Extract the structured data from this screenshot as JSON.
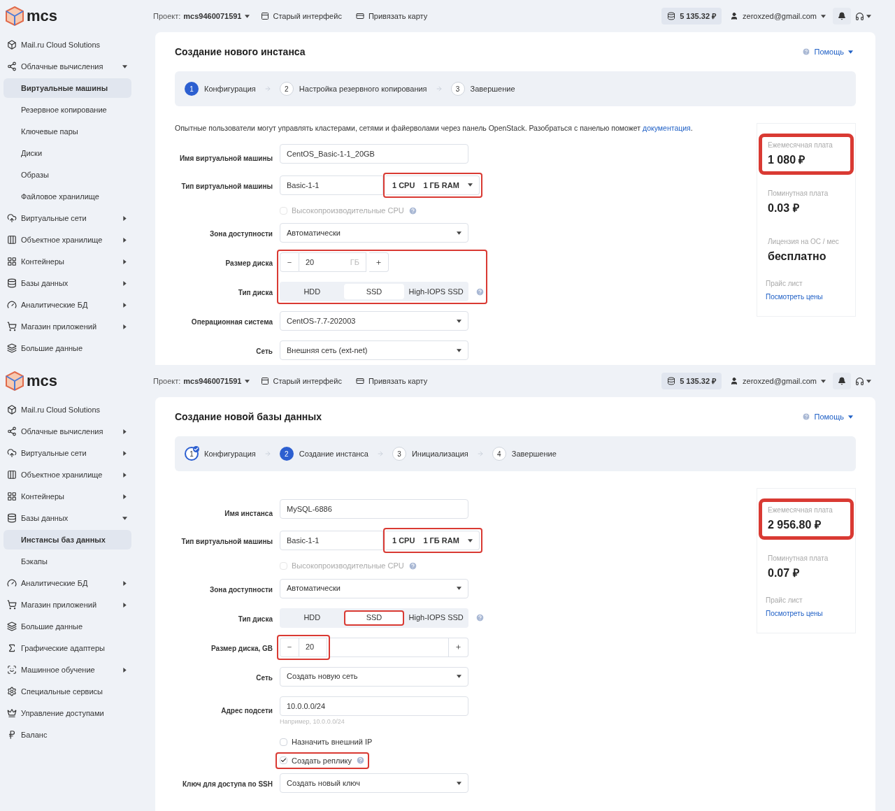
{
  "screens": [
    {
      "logo": "mcs",
      "header": {
        "project_label": "Проект:",
        "project": "mcs9460071591",
        "old_ui": "Старый интерфейс",
        "bind_card": "Привязать карту",
        "balance": "5 135.32 ₽",
        "email": "zeroxzed@gmail.com"
      },
      "sidebar": [
        {
          "kind": "link",
          "label": "Mail.ru Cloud Solutions",
          "selected": false
        },
        {
          "kind": "group",
          "label": "Облачные вычисления",
          "expanded": true,
          "selected": false
        },
        {
          "kind": "sub",
          "label": "Виртуальные машины",
          "selected": true
        },
        {
          "kind": "sub",
          "label": "Резервное копирование",
          "selected": false
        },
        {
          "kind": "sub",
          "label": "Ключевые пары",
          "selected": false
        },
        {
          "kind": "sub",
          "label": "Диски",
          "selected": false
        },
        {
          "kind": "sub",
          "label": "Образы",
          "selected": false
        },
        {
          "kind": "sub",
          "label": "Файловое хранилище",
          "selected": false
        },
        {
          "kind": "group",
          "label": "Виртуальные сети",
          "expanded": false,
          "selected": false
        },
        {
          "kind": "group",
          "label": "Объектное хранилище",
          "expanded": false,
          "selected": false
        },
        {
          "kind": "group",
          "label": "Контейнеры",
          "expanded": false,
          "selected": false
        },
        {
          "kind": "group",
          "label": "Базы данных",
          "expanded": false,
          "selected": false
        },
        {
          "kind": "group",
          "label": "Аналитические БД",
          "expanded": false,
          "selected": false
        },
        {
          "kind": "group",
          "label": "Магазин приложений",
          "expanded": false,
          "selected": false
        },
        {
          "kind": "link",
          "label": "Большие данные",
          "selected": false
        }
      ],
      "title": "Создание нового инстанса",
      "help": "Помощь",
      "steps": [
        {
          "number": "1",
          "label": "Конфигурация",
          "selected": true,
          "done": false
        },
        {
          "number": "2",
          "label": "Настройка резервного копирования",
          "selected": false,
          "done": false
        },
        {
          "number": "3",
          "label": "Завершение",
          "selected": false,
          "done": false
        }
      ],
      "intro": {
        "text": "Опытные пользователи могут управлять кластерами, сетями и файерволами через панель OpenStack. Разобраться с панелью поможет ",
        "link": "документация",
        "end": "."
      },
      "form": [
        {
          "kind": "text",
          "label": "Имя виртуальной машины",
          "value": "CentOS_Basic-1-1_20GB"
        },
        {
          "kind": "flavor",
          "label": "Тип виртуальной машины",
          "value": "Basic-1-1",
          "cpu": "1 CPU",
          "ram": "1 ГБ RAM",
          "highlighted": true
        },
        {
          "kind": "checkbox",
          "text": "Высокопроизводительные CPU",
          "checked": false,
          "disabled": true,
          "help": true,
          "highlighted": false
        },
        {
          "kind": "select",
          "label": "Зона доступности",
          "value": "Автоматически"
        },
        {
          "kind": "group",
          "highlighted": true,
          "rows": [
            {
              "kind": "stepper",
              "label": "Размер диска",
              "value": "20",
              "unit": "ГБ",
              "wide": false,
              "highlighted": false
            },
            {
              "kind": "segments",
              "label": "Тип диска",
              "help": true,
              "options": [
                {
                  "label": "HDD",
                  "selected": false,
                  "highlighted": false
                },
                {
                  "label": "SSD",
                  "selected": true,
                  "highlighted": false
                },
                {
                  "label": "High-IOPS SSD",
                  "selected": false,
                  "highlighted": false
                }
              ]
            }
          ]
        },
        {
          "kind": "select",
          "label": "Операционная система",
          "value": "CentOS-7.7-202003"
        },
        {
          "kind": "select",
          "label": "Сеть",
          "value": "Внешняя сеть (ext-net)"
        }
      ],
      "prices": [
        {
          "label": "Ежемесячная плата",
          "value": "1 080 ₽",
          "highlighted": true
        },
        {
          "label": "Поминутная плата",
          "value": "0.03 ₽",
          "highlighted": false
        },
        {
          "label": "Лицензия на ОС / мес",
          "value": "бесплатно",
          "highlighted": false
        }
      ],
      "price_list": {
        "label": "Прайс лист",
        "link": "Посмотреть цены"
      }
    },
    {
      "logo": "mcs",
      "header": {
        "project_label": "Проект:",
        "project": "mcs9460071591",
        "old_ui": "Старый интерфейс",
        "bind_card": "Привязать карту",
        "balance": "5 135.32 ₽",
        "email": "zeroxzed@gmail.com"
      },
      "sidebar": [
        {
          "kind": "link",
          "label": "Mail.ru Cloud Solutions",
          "selected": false
        },
        {
          "kind": "group",
          "label": "Облачные вычисления",
          "expanded": false,
          "selected": false
        },
        {
          "kind": "group",
          "label": "Виртуальные сети",
          "expanded": false,
          "selected": false
        },
        {
          "kind": "group",
          "label": "Объектное хранилище",
          "expanded": false,
          "selected": false
        },
        {
          "kind": "group",
          "label": "Контейнеры",
          "expanded": false,
          "selected": false
        },
        {
          "kind": "group",
          "label": "Базы данных",
          "expanded": true,
          "selected": false
        },
        {
          "kind": "sub",
          "label": "Инстансы баз данных",
          "selected": true
        },
        {
          "kind": "sub",
          "label": "Бэкапы",
          "selected": false
        },
        {
          "kind": "group",
          "label": "Аналитические БД",
          "expanded": false,
          "selected": false
        },
        {
          "kind": "group",
          "label": "Магазин приложений",
          "expanded": false,
          "selected": false
        },
        {
          "kind": "link",
          "label": "Большие данные",
          "selected": false
        },
        {
          "kind": "link",
          "label": "Графические адаптеры",
          "selected": false
        },
        {
          "kind": "group",
          "label": "Машинное обучение",
          "expanded": false,
          "selected": false
        },
        {
          "kind": "link",
          "label": "Специальные сервисы",
          "selected": false
        },
        {
          "kind": "link",
          "label": "Управление доступами",
          "selected": false
        },
        {
          "kind": "link",
          "label": "Баланс",
          "selected": false
        }
      ],
      "title": "Создание новой базы данных",
      "help": "Помощь",
      "steps": [
        {
          "number": "1",
          "label": "Конфигурация",
          "selected": false,
          "done": true
        },
        {
          "number": "2",
          "label": "Создание инстанса",
          "selected": true,
          "done": false
        },
        {
          "number": "3",
          "label": "Инициализация",
          "selected": false,
          "done": false
        },
        {
          "number": "4",
          "label": "Завершение",
          "selected": false,
          "done": false
        }
      ],
      "form": [
        {
          "kind": "text",
          "label": "Имя инстанса",
          "value": "MySQL-6886"
        },
        {
          "kind": "flavor",
          "label": "Тип виртуальной машины",
          "value": "Basic-1-1",
          "cpu": "1 CPU",
          "ram": "1 ГБ RAM",
          "highlighted": true
        },
        {
          "kind": "checkbox",
          "text": "Высокопроизводительные CPU",
          "checked": false,
          "disabled": true,
          "help": true,
          "highlighted": false
        },
        {
          "kind": "select",
          "label": "Зона доступности",
          "value": "Автоматически"
        },
        {
          "kind": "segments",
          "label": "Тип диска",
          "help": true,
          "options": [
            {
              "label": "HDD",
              "selected": false,
              "highlighted": false
            },
            {
              "label": "SSD",
              "selected": true,
              "highlighted": true
            },
            {
              "label": "High-IOPS SSD",
              "selected": false,
              "highlighted": false
            }
          ]
        },
        {
          "kind": "stepper",
          "label": "Размер диска, GB",
          "value": "20",
          "wide": true,
          "highlighted": true
        },
        {
          "kind": "select",
          "label": "Сеть",
          "value": "Создать новую сеть"
        },
        {
          "kind": "text",
          "label": "Адрес подсети",
          "value": "10.0.0.0/24",
          "hint": "Например, 10.0.0.0/24"
        },
        {
          "kind": "checkbox",
          "text": "Назначить внешний IP",
          "checked": false,
          "disabled": false,
          "help": false,
          "highlighted": false
        },
        {
          "kind": "checkbox",
          "text": "Создать реплику",
          "checked": true,
          "disabled": false,
          "help": true,
          "highlighted": true
        },
        {
          "kind": "select",
          "label": "Ключ для доступа по SSH",
          "value": "Создать новый ключ"
        }
      ],
      "prices": [
        {
          "label": "Ежемесячная плата",
          "value": "2 956.80 ₽",
          "highlighted": true
        },
        {
          "label": "Поминутная плата",
          "value": "0.07 ₽",
          "highlighted": false
        }
      ],
      "price_list": {
        "label": "Прайс лист",
        "link": "Посмотреть цены"
      }
    }
  ]
}
